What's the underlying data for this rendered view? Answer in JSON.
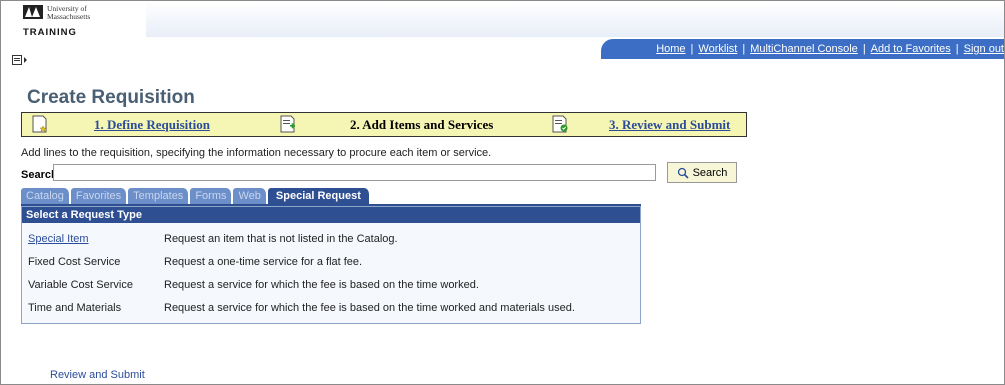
{
  "header": {
    "university_name": "University of Massachusetts",
    "training_label": "TRAINING",
    "nav_links": [
      "Home",
      "Worklist",
      "MultiChannel Console",
      "Add to Favorites",
      "Sign out"
    ]
  },
  "page": {
    "title": "Create Requisition"
  },
  "steps": [
    {
      "label": "1. Define Requisition",
      "icon": "document-star-icon",
      "state": "link"
    },
    {
      "label": "2. Add Items and Services",
      "icon": "document-add-icon",
      "state": "current"
    },
    {
      "label": "3. Review and Submit",
      "icon": "document-check-icon",
      "state": "link"
    }
  ],
  "intro_text": "Add lines to the requisition, specifying the information necessary to procure each item or service.",
  "search": {
    "label": "Search:",
    "value": "",
    "button_label": "Search"
  },
  "tabs": [
    {
      "label": "Catalog",
      "active": false
    },
    {
      "label": "Favorites",
      "active": false
    },
    {
      "label": "Templates",
      "active": false
    },
    {
      "label": "Forms",
      "active": false
    },
    {
      "label": "Web",
      "active": false
    },
    {
      "label": "Special Request",
      "active": true
    }
  ],
  "panel": {
    "title": "Select a Request Type",
    "rows": [
      {
        "name": "Special Item",
        "description": "Request an item that is not listed in the Catalog.",
        "link": true
      },
      {
        "name": "Fixed Cost Service",
        "description": "Request a one-time service for a flat fee.",
        "link": false
      },
      {
        "name": "Variable Cost Service",
        "description": "Request a service for which the fee is based on the time worked.",
        "link": false
      },
      {
        "name": "Time and Materials",
        "description": "Request a service for which the fee is based on the time worked and materials used.",
        "link": false
      }
    ]
  },
  "footer": {
    "review_link": "Review and Submit"
  },
  "colors": {
    "header_band": "#3b6ec4",
    "title": "#4a5f73",
    "steps_bg": "#f5f5b4",
    "tab_active": "#2e4f92",
    "tab_inactive": "#6c8fc9",
    "link": "#2c4d9a"
  }
}
